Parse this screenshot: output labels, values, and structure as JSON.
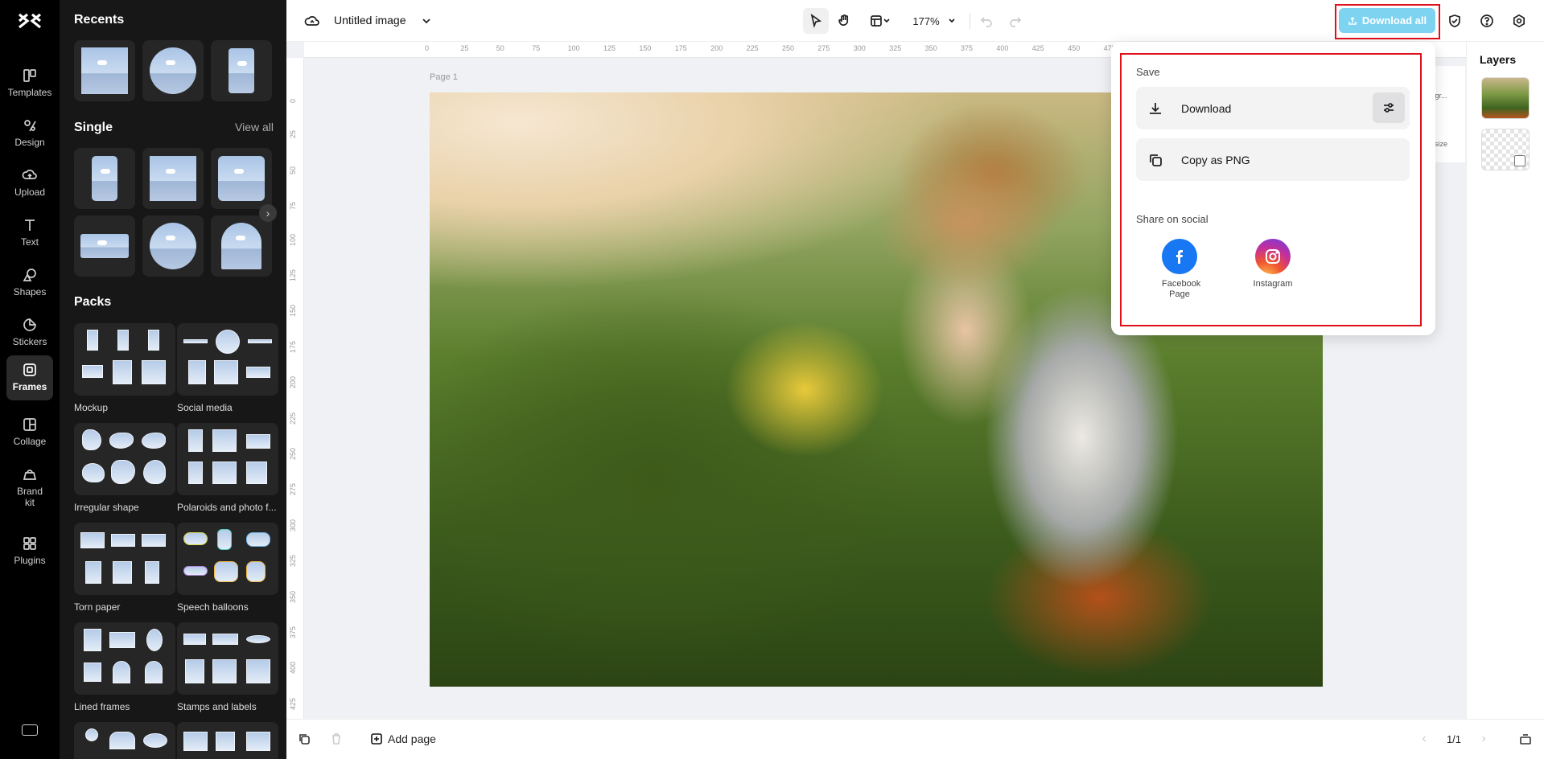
{
  "rail": {
    "items": [
      {
        "label": "Templates",
        "icon": "templates-icon"
      },
      {
        "label": "Design",
        "icon": "design-icon"
      },
      {
        "label": "Upload",
        "icon": "upload-icon"
      },
      {
        "label": "Text",
        "icon": "text-icon"
      },
      {
        "label": "Shapes",
        "icon": "shapes-icon"
      },
      {
        "label": "Stickers",
        "icon": "stickers-icon"
      },
      {
        "label": "Frames",
        "icon": "frames-icon"
      },
      {
        "label": "Collage",
        "icon": "collage-icon"
      },
      {
        "label": "Brand kit",
        "icon": "brand-kit-icon"
      },
      {
        "label": "Plugins",
        "icon": "plugins-icon"
      }
    ],
    "active": "Frames"
  },
  "panel": {
    "recents_title": "Recents",
    "single_title": "Single",
    "view_all": "View all",
    "packs_title": "Packs",
    "packs": [
      "Mockup",
      "Social media",
      "Irregular shape",
      "Polaroids and photo f...",
      "Torn paper",
      "Speech balloons",
      "Lined frames",
      "Stamps and labels"
    ]
  },
  "topbar": {
    "doc_title": "Untitled image",
    "zoom": "177%",
    "download_all": "Download all"
  },
  "canvas": {
    "page_label": "Page 1",
    "ruler_x": [
      "0",
      "25",
      "50",
      "75",
      "100",
      "125",
      "150",
      "175",
      "200",
      "225",
      "250",
      "275",
      "300",
      "325",
      "350",
      "375",
      "400",
      "425",
      "450",
      "475"
    ],
    "ruler_y": [
      "0",
      "25",
      "50",
      "75",
      "100",
      "125",
      "150",
      "175",
      "200",
      "225",
      "250",
      "275",
      "300",
      "325",
      "350",
      "375",
      "400",
      "425"
    ]
  },
  "popup": {
    "save_label": "Save",
    "download": "Download",
    "copy_png": "Copy as PNG",
    "share_label": "Share on social",
    "facebook": "Facebook Page",
    "instagram": "Instagram"
  },
  "mini_panel": {
    "a": "kgr...",
    "b": "size"
  },
  "layers": {
    "title": "Layers"
  },
  "bottombar": {
    "add_page": "Add page",
    "page_count": "1/1"
  },
  "colors": {
    "accent": "#7ed3f0",
    "highlight": "#e0101a",
    "facebook": "#1877f2"
  }
}
